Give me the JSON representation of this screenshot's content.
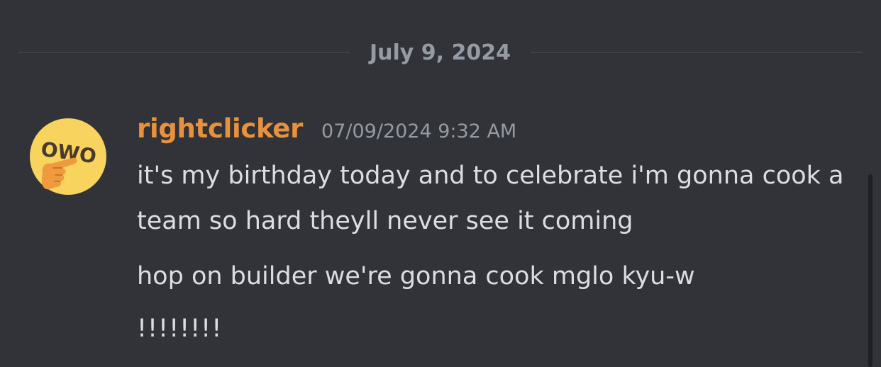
{
  "date_divider": {
    "label": "July 9, 2024"
  },
  "message": {
    "avatar_icon": "owo-pointing-emoji-icon",
    "username": "rightclicker",
    "username_color": "#e8913f",
    "timestamp": "07/09/2024 9:32 AM",
    "lines": [
      "it's my birthday today and to celebrate i'm gonna cook a team so hard theyll never see it coming",
      "hop on builder we're gonna cook mglo kyu-w",
      "!!!!!!!!"
    ]
  },
  "colors": {
    "background": "#313338",
    "text": "#dbdee1",
    "muted": "#949ba4"
  }
}
